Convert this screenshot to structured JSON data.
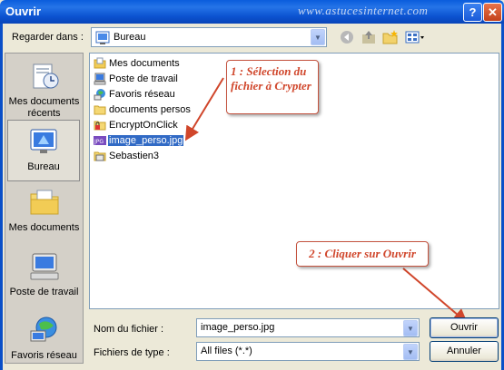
{
  "window": {
    "title": "Ouvrir",
    "watermark": "www.astucesinternet.com",
    "help_label": "?",
    "close_label": "✕"
  },
  "lookin": {
    "label": "Regarder dans :",
    "value": "Bureau"
  },
  "places": [
    {
      "label": "Mes documents récents",
      "icon": "recent-documents-icon"
    },
    {
      "label": "Bureau",
      "icon": "desktop-icon"
    },
    {
      "label": "Mes documents",
      "icon": "my-documents-icon"
    },
    {
      "label": "Poste de travail",
      "icon": "my-computer-icon"
    },
    {
      "label": "Favoris réseau",
      "icon": "network-places-icon"
    }
  ],
  "files": [
    {
      "name": "Mes documents",
      "icon": "my-documents-icon"
    },
    {
      "name": "Poste de travail",
      "icon": "my-computer-icon"
    },
    {
      "name": "Favoris réseau",
      "icon": "network-places-icon"
    },
    {
      "name": "documents persos",
      "icon": "folder-icon"
    },
    {
      "name": "EncryptOnClick",
      "icon": "encrypted-folder-icon"
    },
    {
      "name": "image_perso.jpg",
      "icon": "jpg-file-icon",
      "selected": true
    },
    {
      "name": "Sebastien3",
      "icon": "user-folder-icon"
    }
  ],
  "annotations": {
    "step1": "1 : Sélection du fichier à Crypter",
    "step2": "2 : Cliquer sur Ouvrir"
  },
  "filename": {
    "label": "Nom du fichier :",
    "value": "image_perso.jpg"
  },
  "filetype": {
    "label": "Fichiers de type :",
    "value": "All files (*.*)"
  },
  "buttons": {
    "open": "Ouvrir",
    "cancel": "Annuler"
  },
  "colors": {
    "titlebar": "#0a5ddc",
    "selection": "#316ac5",
    "annotation": "#d0462b"
  }
}
